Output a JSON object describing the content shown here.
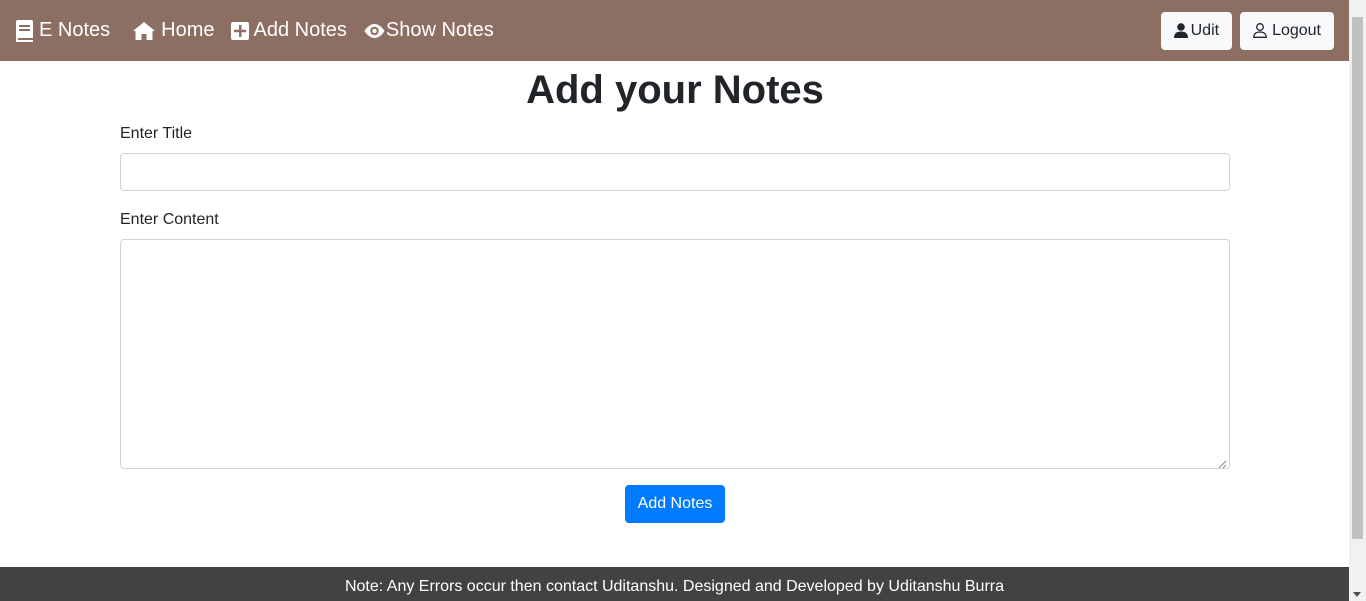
{
  "navbar": {
    "brand": "E Notes",
    "links": [
      {
        "label": "Home",
        "icon": "home-icon"
      },
      {
        "label": "Add Notes",
        "icon": "plus-square-icon"
      },
      {
        "label": "Show Notes",
        "icon": "eye-icon"
      }
    ],
    "user_button": "Udit",
    "logout_button": "Logout",
    "bg_color": "#8d6e63"
  },
  "form": {
    "heading": "Add your Notes",
    "title_label": "Enter Title",
    "title_value": "",
    "content_label": "Enter Content",
    "content_value": "",
    "submit_label": "Add Notes",
    "submit_color": "#007bff"
  },
  "footer": {
    "text": "Note: Any Errors occur then contact Uditanshu. Designed and Developed by Uditanshu Burra",
    "bg_color": "#424242"
  }
}
